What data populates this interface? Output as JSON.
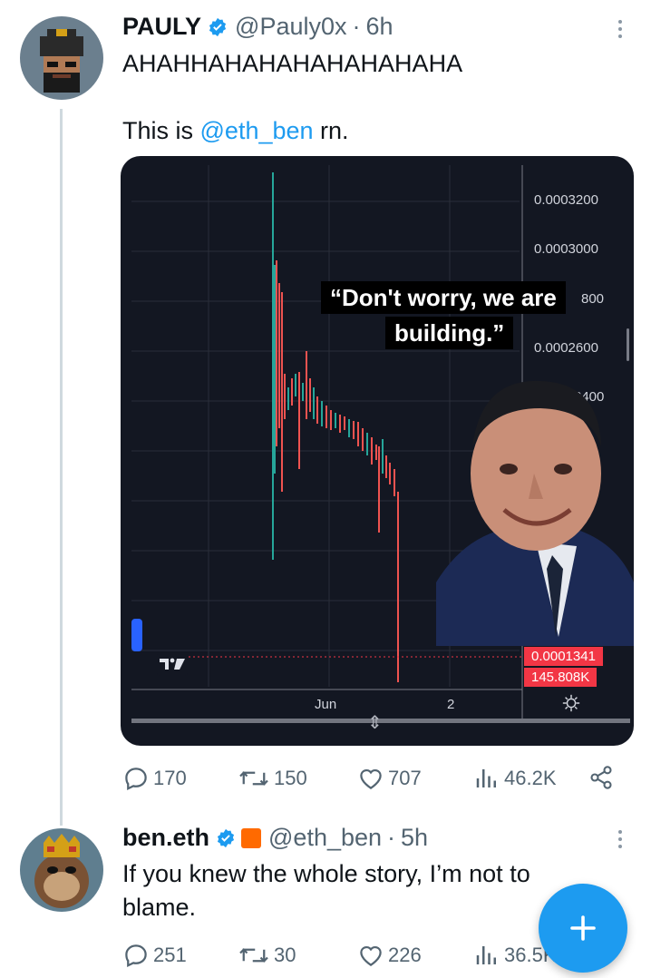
{
  "tweet1": {
    "display_name": "PAULY",
    "handle": "@Pauly0x",
    "separator": "·",
    "time": "6h",
    "line1": "AHAHHAHAHAHAHAHAHAHA",
    "line2_prefix": "This is ",
    "line2_mention": "@eth_ben",
    "line2_suffix": " rn.",
    "media": {
      "price_labels": [
        "0.0003200",
        "0.0003000",
        "800",
        "0.0002600",
        "2400"
      ],
      "caption_line1": "“Don't worry, we are",
      "caption_line2": "building.”",
      "current_price": "0.0001341",
      "volume": "145.808K",
      "x_labels": [
        "Jun",
        "2"
      ],
      "logo": "TV"
    },
    "stats": {
      "replies": "170",
      "reposts": "150",
      "likes": "707",
      "views": "46.2K"
    }
  },
  "tweet2": {
    "display_name": "ben.eth",
    "handle": "@eth_ben",
    "separator": "·",
    "time": "5h",
    "line1": "If you knew the whole story, I’m not to",
    "line2": "blame.",
    "stats": {
      "replies": "251",
      "reposts": "30",
      "likes": "226",
      "views": "36.5K"
    }
  },
  "colors": {
    "accent": "#1d9bf0",
    "muted": "#536471",
    "chart_bg": "#131722",
    "candle_up": "#26a69a",
    "candle_down": "#ef5350"
  },
  "icons": [
    "verified-badge-icon",
    "more-icon",
    "reply-icon",
    "repost-icon",
    "like-icon",
    "views-icon",
    "share-icon",
    "compose-icon",
    "organization-badge-icon"
  ]
}
